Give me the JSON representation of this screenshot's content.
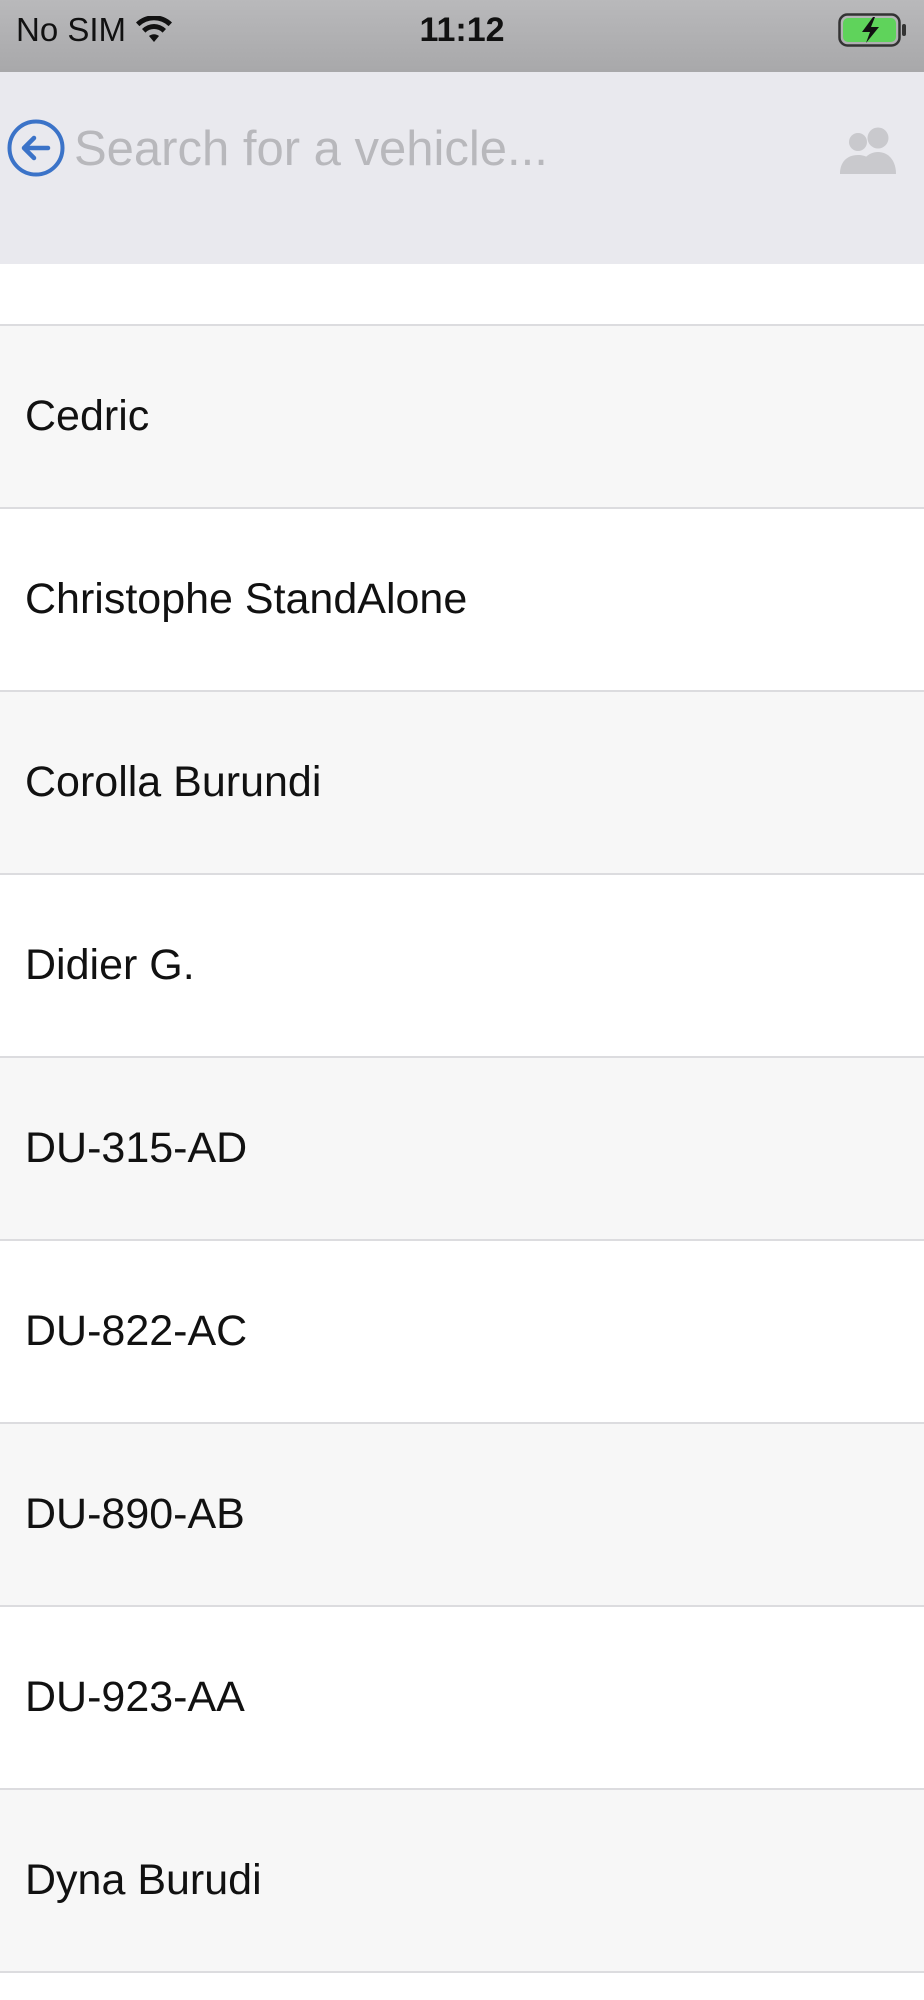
{
  "status_bar": {
    "carrier": "No SIM",
    "time": "11:12",
    "battery_state": "charging"
  },
  "header": {
    "back_icon": "arrow-left-circle-icon",
    "search_placeholder": "Search for a vehicle...",
    "search_value": "",
    "people_icon": "people-group-icon"
  },
  "colors": {
    "accent": "#3b73c8",
    "header_bg": "#e9e9ee",
    "status_bar_bg": "#b0b0b2",
    "row_alt_bg": "#f7f7f7",
    "divider": "#dcdcdf",
    "placeholder": "#b8b8bc",
    "battery_fill": "#5fd35b"
  },
  "vehicles": [
    {
      "label": "Cedric"
    },
    {
      "label": "Christophe StandAlone"
    },
    {
      "label": "Corolla Burundi"
    },
    {
      "label": "Didier G."
    },
    {
      "label": "DU-315-AD"
    },
    {
      "label": "DU-822-AC"
    },
    {
      "label": "DU-890-AB"
    },
    {
      "label": "DU-923-AA"
    },
    {
      "label": "Dyna Burudi"
    }
  ]
}
